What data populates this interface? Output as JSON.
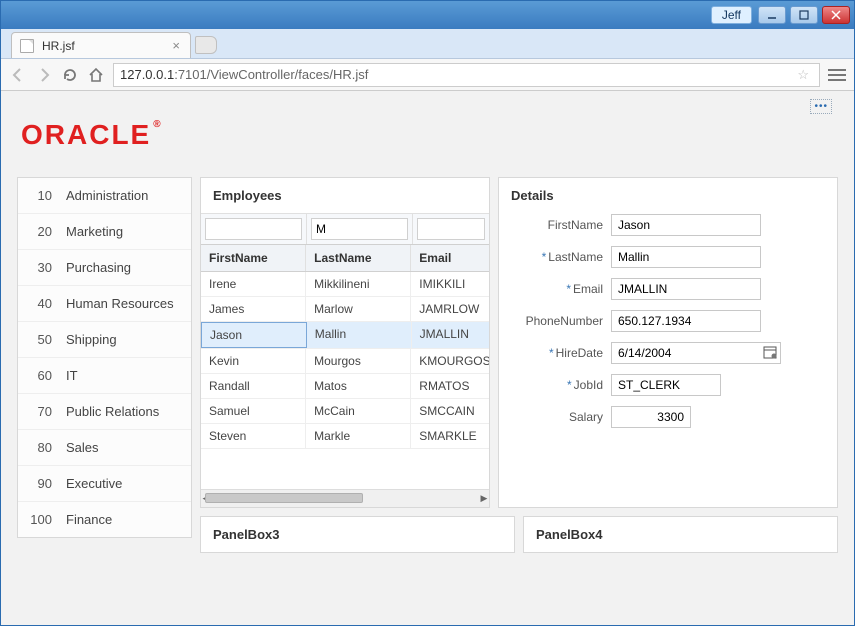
{
  "window": {
    "user": "Jeff"
  },
  "browser": {
    "tab_title": "HR.jsf",
    "url_host": "127.0.0.1",
    "url_port_path": ":7101/ViewController/faces/HR.jsf"
  },
  "logo": "ORACLE",
  "departments": [
    {
      "id": "10",
      "name": "Administration"
    },
    {
      "id": "20",
      "name": "Marketing"
    },
    {
      "id": "30",
      "name": "Purchasing"
    },
    {
      "id": "40",
      "name": "Human Resources"
    },
    {
      "id": "50",
      "name": "Shipping"
    },
    {
      "id": "60",
      "name": "IT"
    },
    {
      "id": "70",
      "name": "Public Relations"
    },
    {
      "id": "80",
      "name": "Sales"
    },
    {
      "id": "90",
      "name": "Executive"
    },
    {
      "id": "100",
      "name": "Finance"
    }
  ],
  "employees": {
    "title": "Employees",
    "filter": {
      "first": "",
      "last": "M",
      "email": ""
    },
    "columns": {
      "first": "FirstName",
      "last": "LastName",
      "email": "Email"
    },
    "rows": [
      {
        "first": "Irene",
        "last": "Mikkilineni",
        "email": "IMIKKILI"
      },
      {
        "first": "James",
        "last": "Marlow",
        "email": "JAMRLOW"
      },
      {
        "first": "Jason",
        "last": "Mallin",
        "email": "JMALLIN"
      },
      {
        "first": "Kevin",
        "last": "Mourgos",
        "email": "KMOURGOS"
      },
      {
        "first": "Randall",
        "last": "Matos",
        "email": "RMATOS"
      },
      {
        "first": "Samuel",
        "last": "McCain",
        "email": "SMCCAIN"
      },
      {
        "first": "Steven",
        "last": "Markle",
        "email": "SMARKLE"
      }
    ],
    "selected_index": 2
  },
  "details": {
    "title": "Details",
    "labels": {
      "first": "FirstName",
      "last": "LastName",
      "email": "Email",
      "phone": "PhoneNumber",
      "hire": "HireDate",
      "job": "JobId",
      "salary": "Salary"
    },
    "values": {
      "first": "Jason",
      "last": "Mallin",
      "email": "JMALLIN",
      "phone": "650.127.1934",
      "hire": "6/14/2004",
      "job": "ST_CLERK",
      "salary": "3300"
    }
  },
  "panel3_title": "PanelBox3",
  "panel4_title": "PanelBox4"
}
